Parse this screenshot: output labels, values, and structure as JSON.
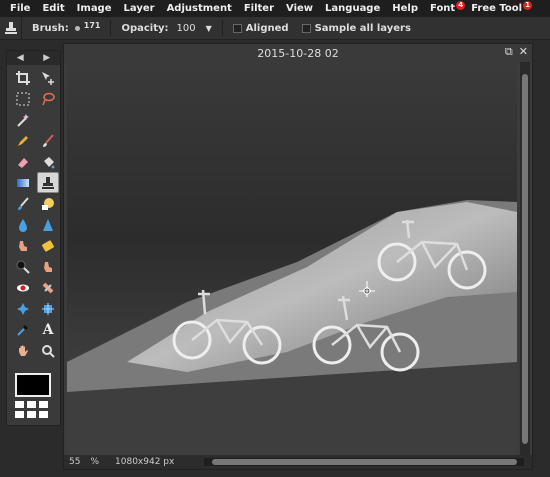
{
  "menu": [
    {
      "label": "File"
    },
    {
      "label": "Edit"
    },
    {
      "label": "Image"
    },
    {
      "label": "Layer"
    },
    {
      "label": "Adjustment"
    },
    {
      "label": "Filter"
    },
    {
      "label": "View"
    },
    {
      "label": "Language"
    },
    {
      "label": "Help"
    },
    {
      "label": "Font",
      "badge": "4"
    },
    {
      "label": "Free Tool",
      "badge": "1"
    }
  ],
  "options": {
    "brush_label": "Brush:",
    "brush_size": "171",
    "opacity_label": "Opacity:",
    "opacity_value": "100",
    "aligned_label": "Aligned",
    "sample_label": "Sample all layers"
  },
  "document": {
    "title": "2015-10-28 02",
    "zoom": "55",
    "zoom_unit": "%",
    "dimensions": "1080x942 px"
  },
  "tools": [
    "crop-icon",
    "move-icon",
    "marquee-icon",
    "lasso-icon",
    "magic-wand-icon",
    "blank",
    "pencil-icon",
    "brush-icon",
    "eraser-icon",
    "paint-bucket-icon",
    "gradient-icon",
    "clone-stamp-icon",
    "color-replace-icon",
    "drawing-icon",
    "blur-icon",
    "sharpen-icon",
    "smudge-icon",
    "sponge-icon",
    "dodge-icon",
    "burn-icon",
    "red-eye-icon",
    "spot-heal-icon",
    "bloat-icon",
    "pinch-icon",
    "color-picker-icon",
    "type-icon",
    "hand-icon",
    "zoom-icon"
  ],
  "colors": {
    "foreground": "#000000",
    "background": "#ffffff"
  }
}
